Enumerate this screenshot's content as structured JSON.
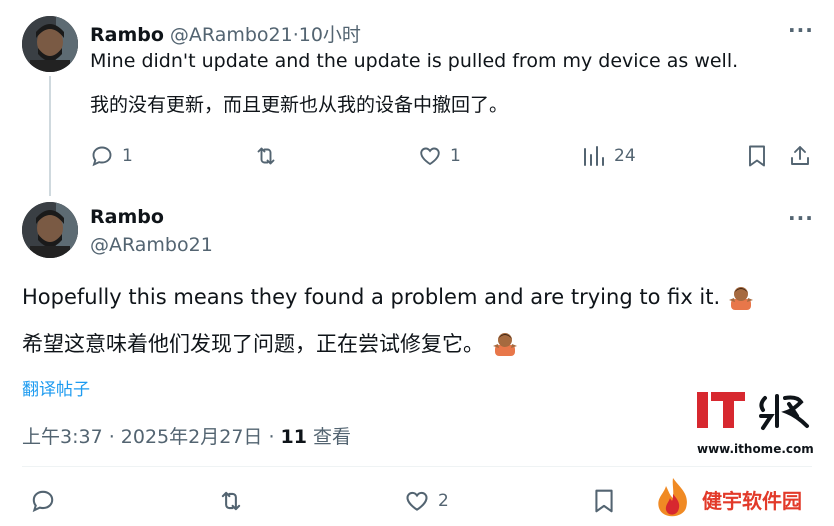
{
  "reply": {
    "author_name": "Rambo",
    "author_handle": "@ARambo21",
    "time_sep": " · ",
    "time": "10小时",
    "text_en": "Mine didn't update and the update is pulled from my device as well.",
    "text_zh": "我的没有更新，而且更新也从我的设备中撤回了。",
    "more": "···",
    "actions": {
      "replies": "1",
      "retweets": "",
      "likes": "1",
      "views": "24"
    }
  },
  "main": {
    "author_name": "Rambo",
    "author_handle": "@ARambo21",
    "more": "···",
    "text_en": "Hopefully this means they found a problem and are trying to fix it.",
    "text_zh": "希望这意味着他们发现了问题，正在尝试修复它。",
    "translate_link": "翻译帖子",
    "timestamp": "上午3:37 · 2025年2月27日 · ",
    "views_count": "11",
    "views_label": " 查看",
    "actions": {
      "replies": "",
      "retweets": "",
      "likes": "2"
    }
  },
  "watermarks": {
    "ithome_url": "www.ithome.com",
    "jianyu": "健宇软件园"
  },
  "colors": {
    "text": "#0f1419",
    "muted": "#536471",
    "link": "#1d9bf0",
    "ithome_red": "#d7282f"
  }
}
